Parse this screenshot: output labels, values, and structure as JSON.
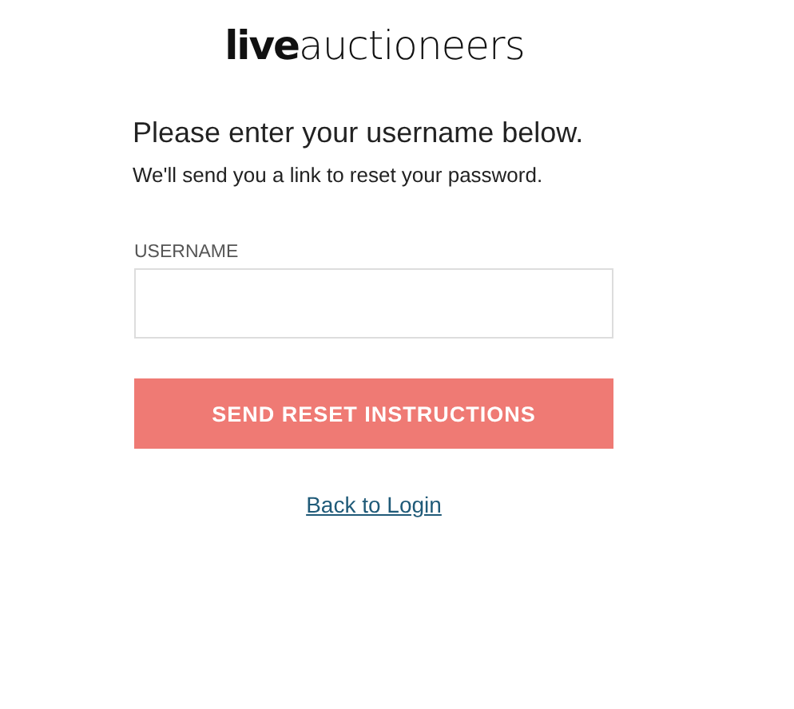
{
  "logo": "**live**auctioneers",
  "heading": "Please enter your username below.",
  "subtitle": "We'll send you a link to reset your password.",
  "username": {
    "label": "USERNAME"
  },
  "submit_button": "SEND RESET INSTRUCTIONS",
  "back_link": "Back to Login"
}
